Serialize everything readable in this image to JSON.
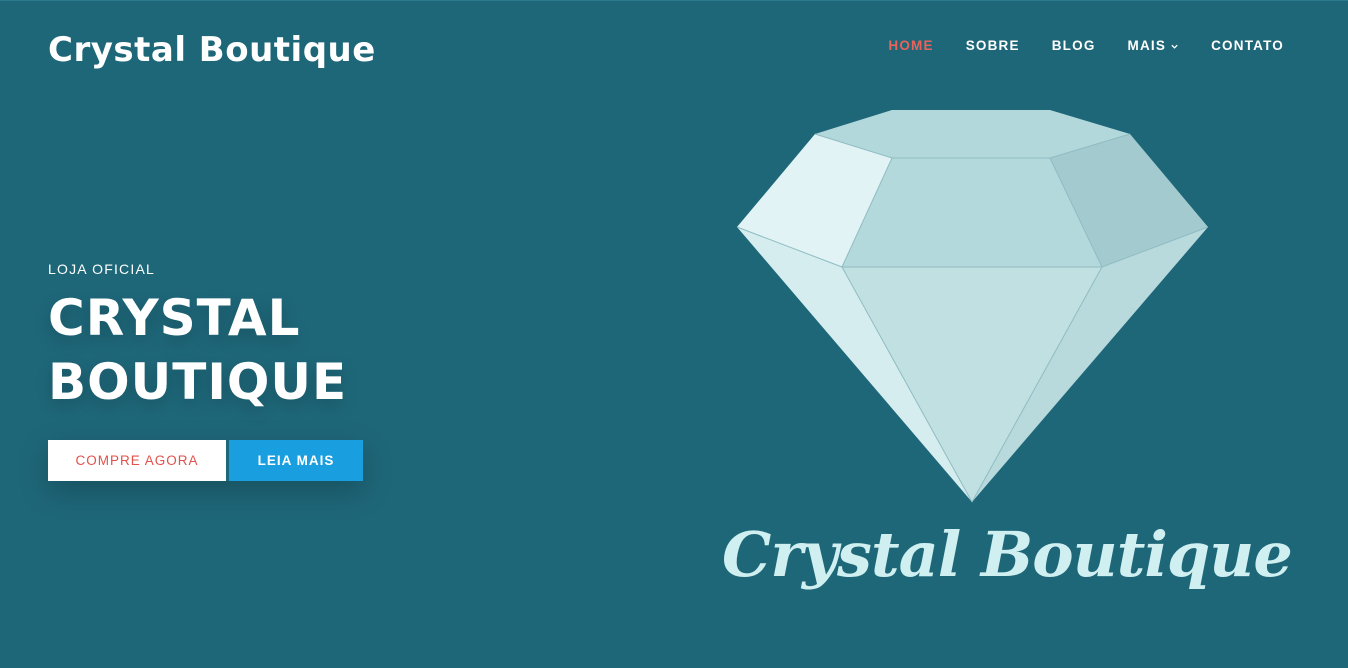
{
  "header": {
    "brand": "Crystal Boutique",
    "nav": [
      {
        "label": "HOME",
        "active": true
      },
      {
        "label": "SOBRE",
        "active": false
      },
      {
        "label": "BLOG",
        "active": false
      },
      {
        "label": "MAIS",
        "active": false,
        "has_dropdown": true
      },
      {
        "label": "CONTATO",
        "active": false
      }
    ]
  },
  "hero": {
    "eyebrow": "LOJA OFICIAL",
    "title_line1": "CRYSTAL",
    "title_line2": "BOUTIQUE",
    "primary_button": "COMPRE AGORA",
    "secondary_button": "LEIA MAIS"
  },
  "logo": {
    "icon": "diamond-icon",
    "script_text": "Crystal Boutique"
  },
  "colors": {
    "background": "#1e6779",
    "nav_active": "#e8635c",
    "primary_button_text": "#e0524b",
    "secondary_button_bg": "#199fdf",
    "logo_text": "#cfeff0"
  }
}
